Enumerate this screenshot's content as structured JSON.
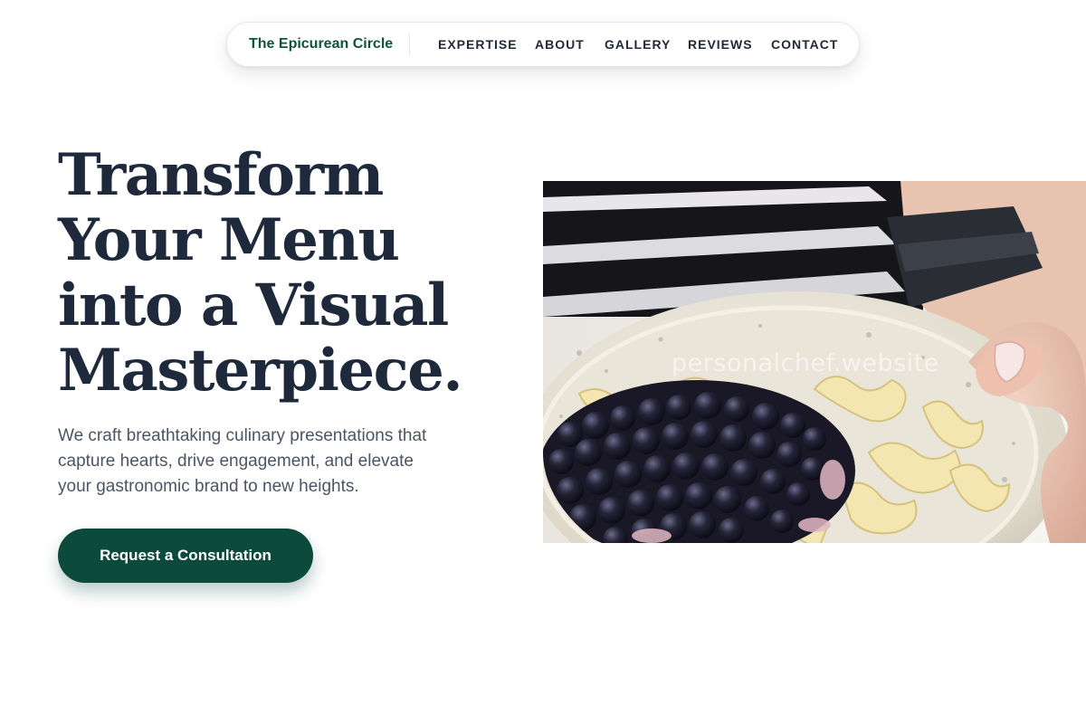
{
  "nav": {
    "brand": "The Epicurean Circle",
    "links": [
      "EXPERTISE",
      "ABOUT",
      "GALLERY",
      "REVIEWS",
      "CONTACT"
    ]
  },
  "hero": {
    "title_lines": [
      "Transform",
      "Your Menu",
      "into a Visual",
      "Masterpiece."
    ],
    "subtitle_lines": [
      "We craft breathtaking culinary presentations that",
      "capture hearts, drive engagement, and elevate",
      "your gastronomic brand to new heights."
    ],
    "cta_label": "Request a Consultation",
    "image_watermark": "personalchef.website"
  },
  "colors": {
    "brand_green": "#0f5340",
    "cta_green": "#0c4a3c",
    "heading_navy": "#1e293b",
    "body_gray": "#4b5563"
  }
}
